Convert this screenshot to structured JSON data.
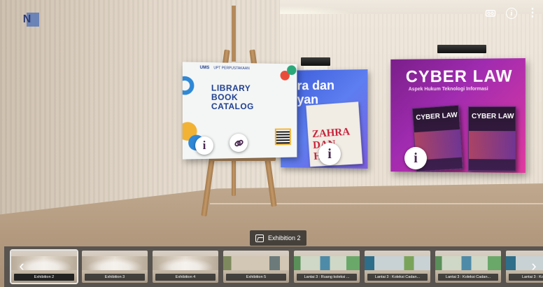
{
  "app": {
    "logo_text": "N"
  },
  "top_right": {
    "vr_icon": "vr-headset-icon",
    "info_icon": "info-icon",
    "info_glyph": "i",
    "menu_glyph": "⋮"
  },
  "posters": {
    "catalog": {
      "header_left": "UMS",
      "header_right": "UPT PERPUSTAKAAN",
      "title": "LIBRARY\nBOOK\nCATALOG"
    },
    "blue": {
      "title": "ra dan\nyan",
      "book_title": "ZAHRA\nDAN\nHAN"
    },
    "cyber": {
      "title": "CYBER LAW",
      "subtitle": "Aspek Hukum Teknologi Informasi",
      "book_title": "CYBER LAW"
    }
  },
  "hotspots": {
    "info_glyph": "i"
  },
  "scene_label": "Exhibition 2",
  "thumbnails": [
    {
      "label": "Exhibition 2",
      "active": true
    },
    {
      "label": "Exhibition 3",
      "active": false
    },
    {
      "label": "Exhibition 4",
      "active": false
    },
    {
      "label": "Exhibition 5",
      "active": false
    },
    {
      "label": "Lantai 3 : Ruang koleksi ...",
      "active": false
    },
    {
      "label": "Lantai 3 : Koleksi Cadan...",
      "active": false
    },
    {
      "label": "Lantai 3 : Koleksi Cadan...",
      "active": false
    },
    {
      "label": "Lantai 3 : Koleksi ...",
      "active": false
    }
  ],
  "nav": {
    "prev": "‹",
    "next": "›"
  }
}
